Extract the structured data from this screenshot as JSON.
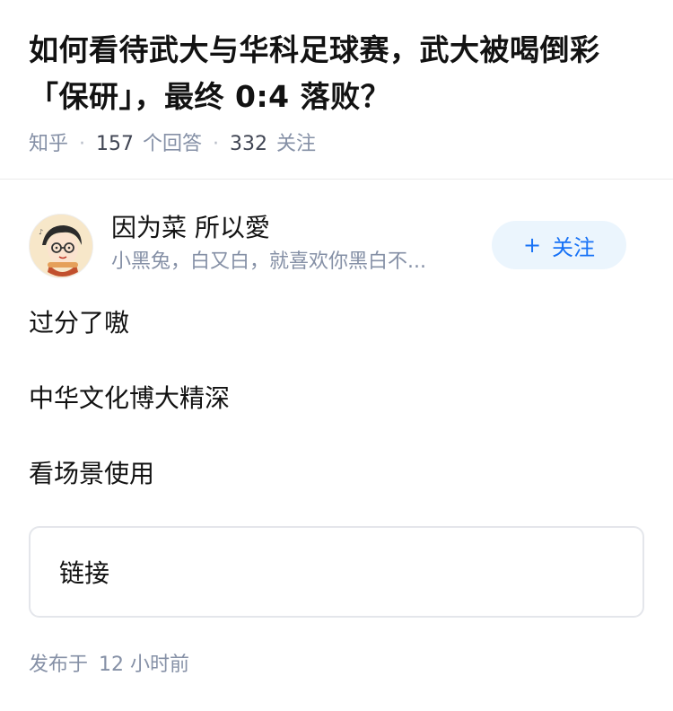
{
  "question": {
    "title": "如何看待武大与华科足球赛，武大被喝倒彩「保研」，最终 0:4 落败？",
    "site": "知乎",
    "answers_count": "157",
    "answers_label": "个回答",
    "followers_count": "332",
    "followers_label": "关注",
    "separator": "·"
  },
  "author": {
    "name": "因为菜 所以愛",
    "bio": "小黑兔，白又白，就喜欢你黑白不...",
    "follow_label": "关注",
    "follow_icon": "plus-icon"
  },
  "answer": {
    "paragraphs": [
      "过分了嗷",
      "中华文化博大精深",
      "看场景使用"
    ],
    "link_card_label": "链接"
  },
  "footer": {
    "published_prefix": "发布于",
    "published_time": "12 小时前"
  },
  "colors": {
    "text_primary": "#121212",
    "text_secondary": "#8590a6",
    "accent_blue": "#1772f6",
    "follow_bg": "#ebf5fd",
    "divider": "#ebebeb"
  }
}
